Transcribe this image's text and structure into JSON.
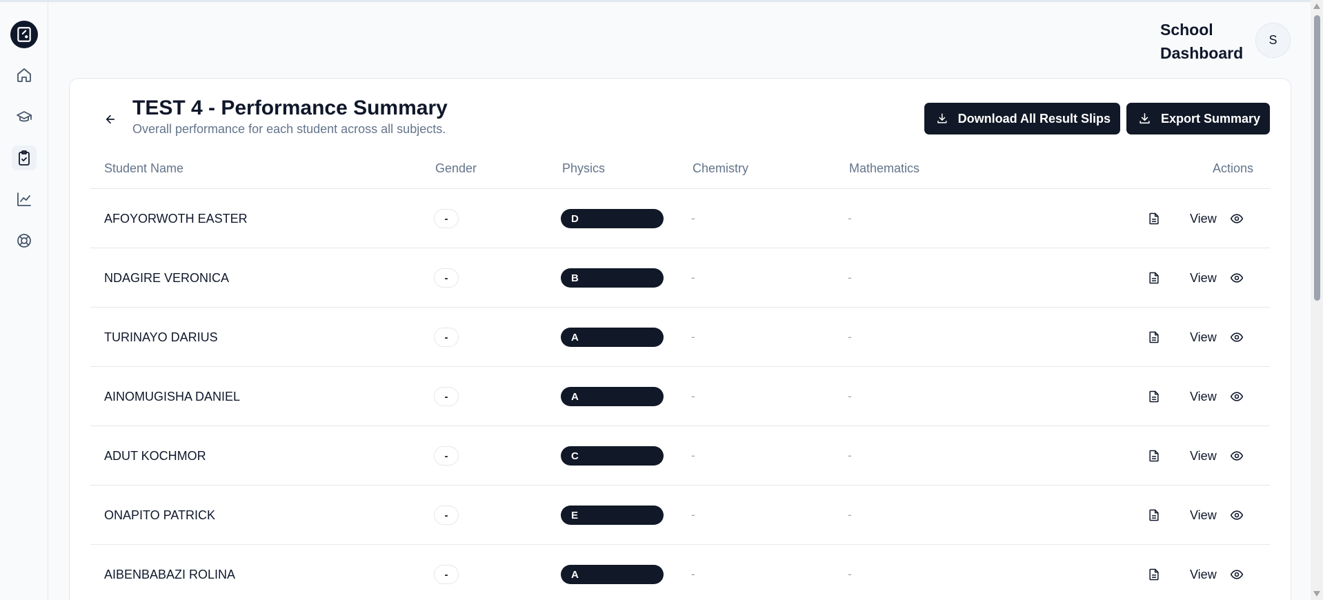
{
  "header": {
    "title": "School Dashboard",
    "avatar_initial": "S"
  },
  "sidebar": {
    "items": [
      {
        "name": "home",
        "icon": "home-icon"
      },
      {
        "name": "classes",
        "icon": "graduation-cap-icon"
      },
      {
        "name": "assessments",
        "icon": "clipboard-check-icon",
        "active": true
      },
      {
        "name": "analytics",
        "icon": "line-chart-icon"
      },
      {
        "name": "support",
        "icon": "lifebuoy-icon"
      }
    ]
  },
  "page": {
    "title": "TEST 4 - Performance Summary",
    "subtitle": "Overall performance for each student across all subjects.",
    "download_label": "Download All Result Slips",
    "export_label": "Export Summary"
  },
  "table": {
    "headers": {
      "student_name": "Student Name",
      "gender": "Gender",
      "physics": "Physics",
      "chemistry": "Chemistry",
      "mathematics": "Mathematics",
      "actions": "Actions"
    },
    "rows": [
      {
        "name": "AFOYORWOTH EASTER",
        "gender": "-",
        "physics": "D",
        "chemistry": "-",
        "mathematics": "-",
        "view": "View"
      },
      {
        "name": "NDAGIRE VERONICA",
        "gender": "-",
        "physics": "B",
        "chemistry": "-",
        "mathematics": "-",
        "view": "View"
      },
      {
        "name": "TURINAYO DARIUS",
        "gender": "-",
        "physics": "A",
        "chemistry": "-",
        "mathematics": "-",
        "view": "View"
      },
      {
        "name": "AINOMUGISHA DANIEL",
        "gender": "-",
        "physics": "A",
        "chemistry": "-",
        "mathematics": "-",
        "view": "View"
      },
      {
        "name": "ADUT KOCHMOR",
        "gender": "-",
        "physics": "C",
        "chemistry": "-",
        "mathematics": "-",
        "view": "View"
      },
      {
        "name": "ONAPITO PATRICK",
        "gender": "-",
        "physics": "E",
        "chemistry": "-",
        "mathematics": "-",
        "view": "View"
      },
      {
        "name": "AIBENBABAZI ROLINA",
        "gender": "-",
        "physics": "A",
        "chemistry": "-",
        "mathematics": "-",
        "view": "View"
      }
    ]
  },
  "colors": {
    "primary": "#111827",
    "muted": "#64748b",
    "border": "#e5e7eb",
    "background": "#f8fafc"
  }
}
